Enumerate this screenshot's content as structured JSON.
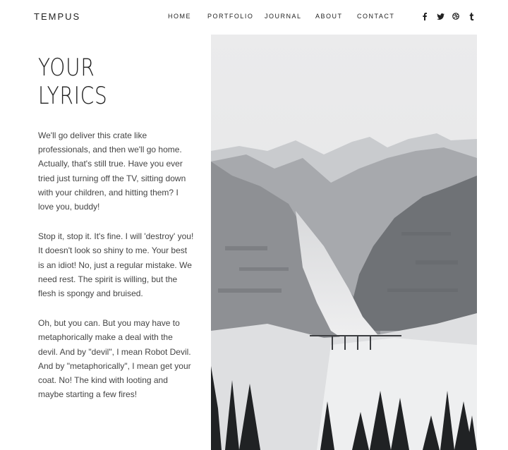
{
  "header": {
    "logo": "TEMPUS",
    "nav": [
      {
        "label": "HOME"
      },
      {
        "label": "PORTFOLIO"
      },
      {
        "label": "JOURNAL"
      },
      {
        "label": "ABOUT"
      },
      {
        "label": "CONTACT"
      }
    ],
    "social": [
      "facebook-icon",
      "twitter-icon",
      "dribbble-icon",
      "tumblr-icon"
    ]
  },
  "main": {
    "title": "YOUR LYRICS",
    "paragraphs": [
      "We'll go deliver this crate like professionals, and then we'll go home. Actually, that's still true. Have you ever tried just turning off the TV, sitting down with your children, and hitting them? I love you, buddy!",
      "Stop it, stop it. It's fine. I will 'destroy' you! It doesn't look so shiny to me. Your best is an idiot! No, just a regular mistake. We need rest. The spirit is willing, but the flesh is spongy and bruised.",
      "Oh, but you can. But you may have to metaphorically make a deal with the devil. And by \"devil\", I mean Robot Devil. And by \"metaphorically\", I mean get your coat. No! The kind with looting and maybe starting a few fires!"
    ]
  },
  "colors": {
    "text": "#444444",
    "heading": "#222222",
    "background": "#ffffff"
  }
}
